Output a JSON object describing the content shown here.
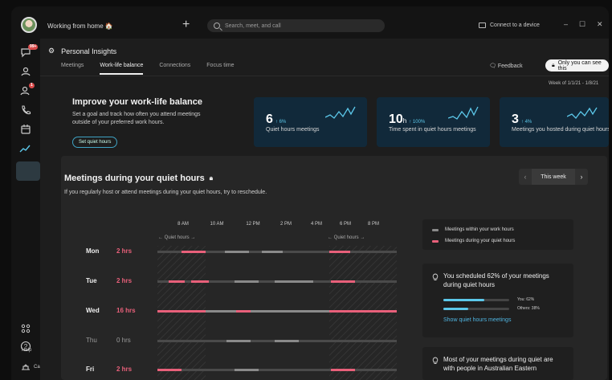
{
  "titlebar": {
    "status": "Working from home 🏠",
    "search_placeholder": "Search, meet, and call",
    "connect_label": "Connect to a device",
    "minimize": "–",
    "maximize": "☐",
    "close": "✕"
  },
  "rail": {
    "messages_badge": "99+",
    "calls_badge": "1",
    "help_label": "Help",
    "calendar_label": "Cal"
  },
  "header": {
    "title": "Personal Insights",
    "tabs": [
      {
        "label": "Meetings"
      },
      {
        "label": "Work-life balance"
      },
      {
        "label": "Connections"
      },
      {
        "label": "Focus time"
      }
    ],
    "feedback_label": "Feedback",
    "visibility_label": "Only you can see this",
    "week_of": "Week of 1/1/21 - 1/8/21"
  },
  "intro": {
    "title": "Improve your work-life balance",
    "description": "Set a goal and track how often you attend meetings outside of your preferred work hours.",
    "button_label": "Set quiet hours"
  },
  "stats": [
    {
      "value": "6",
      "unit": "",
      "delta": "↑ 6%",
      "label": "Quiet hours meetings"
    },
    {
      "value": "10",
      "unit": "h",
      "delta": "↑ 100%",
      "label": "Time spent in quiet hours meetings"
    },
    {
      "value": "3",
      "unit": "",
      "delta": "↑ 4%",
      "label": "Meetings you hosted during quiet hours"
    }
  ],
  "quiet_panel": {
    "title": "Meetings during your quiet hours",
    "subtitle": "If you regularly host or attend meetings during your quiet hours, try to reschedule.",
    "week_label": "This week",
    "prev": "‹",
    "next": "›",
    "hours": [
      "8 AM",
      "10 AM",
      "12 PM",
      "2 PM",
      "4 PM",
      "6 PM",
      "8 PM"
    ],
    "quiet_tag_left": "← Quiet hours →",
    "quiet_tag_right": "← Quiet hours →",
    "days": [
      {
        "day": "Mon",
        "hours": "2 hrs",
        "dim": false
      },
      {
        "day": "Tue",
        "hours": "2 hrs",
        "dim": false
      },
      {
        "day": "Wed",
        "hours": "16 hrs",
        "dim": false
      },
      {
        "day": "Thu",
        "hours": "0 hrs",
        "dim": true
      },
      {
        "day": "Fri",
        "hours": "2 hrs",
        "dim": false
      }
    ],
    "legend": {
      "work": "Meetings within your work hours",
      "quiet": "Meetings during your quiet hours"
    },
    "tip1": {
      "text": "You scheduled 62% of your meetings during quiet hours",
      "you_label": "You: 62%",
      "others_label": "Others: 38%",
      "you_value": 62,
      "others_value": 38,
      "link": "Show quiet hours meetings"
    },
    "tip2": {
      "text": "Most of your meetings during quiet are with people in Australian Eastern"
    }
  },
  "colors": {
    "accent": "#5cc8ea",
    "quiet": "#e8607a",
    "work": "#8a8a8a",
    "card": "#11293a"
  }
}
